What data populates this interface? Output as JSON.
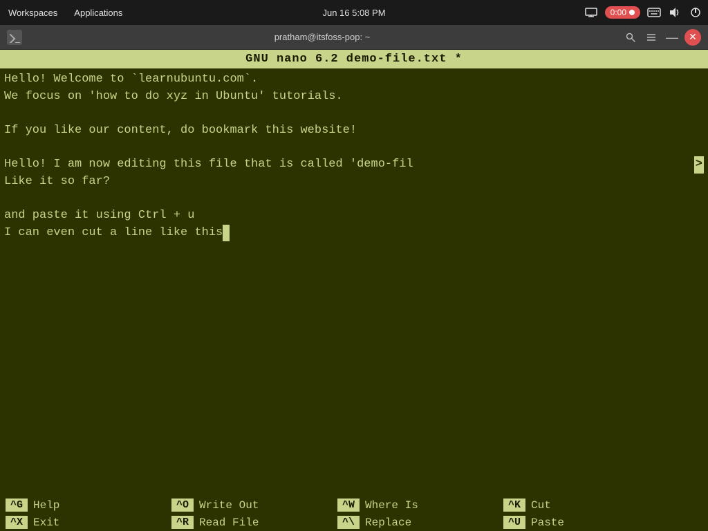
{
  "systembar": {
    "workspaces_label": "Workspaces",
    "applications_label": "Applications",
    "datetime": "Jun 16  5:08 PM",
    "record_time": "0:00",
    "title": "pratham@itsfoss-pop: ~"
  },
  "nano": {
    "header": "GNU nano 6.2                demo-file.txt *",
    "lines": [
      "Hello! Welcome to `learnubuntu.com`.",
      "We focus on 'how to do xyz in Ubuntu' tutorials.",
      "",
      "If you like our content, do bookmark this website!",
      "",
      "Hello! I am now editing this file that is called 'demo-fil",
      "Like it so far?",
      "",
      "and paste it using Ctrl + u",
      "I can even cut a line like this"
    ],
    "overflow_line_index": 5,
    "overflow_marker": ">",
    "cursor_line": 9,
    "shortcuts": [
      [
        {
          "key": "^G",
          "label": "Help"
        },
        {
          "key": "^O",
          "label": "Write Out"
        },
        {
          "key": "^W",
          "label": "Where Is"
        },
        {
          "key": "^K",
          "label": "Cut"
        }
      ],
      [
        {
          "key": "^X",
          "label": "Exit"
        },
        {
          "key": "^R",
          "label": "Read File"
        },
        {
          "key": "^\\ ",
          "label": "Replace"
        },
        {
          "key": "^U",
          "label": "Paste"
        }
      ]
    ]
  },
  "terminal": {
    "title": "pratham@itsfoss-pop: ~",
    "icon": "▶"
  },
  "icons": {
    "search": "🔍",
    "menu": "☰",
    "minimize": "—",
    "close": "✕",
    "screen": "🖥",
    "keyboard": "⌨",
    "volume": "🔊",
    "power": "⏻",
    "terminal_icon": "❯"
  }
}
